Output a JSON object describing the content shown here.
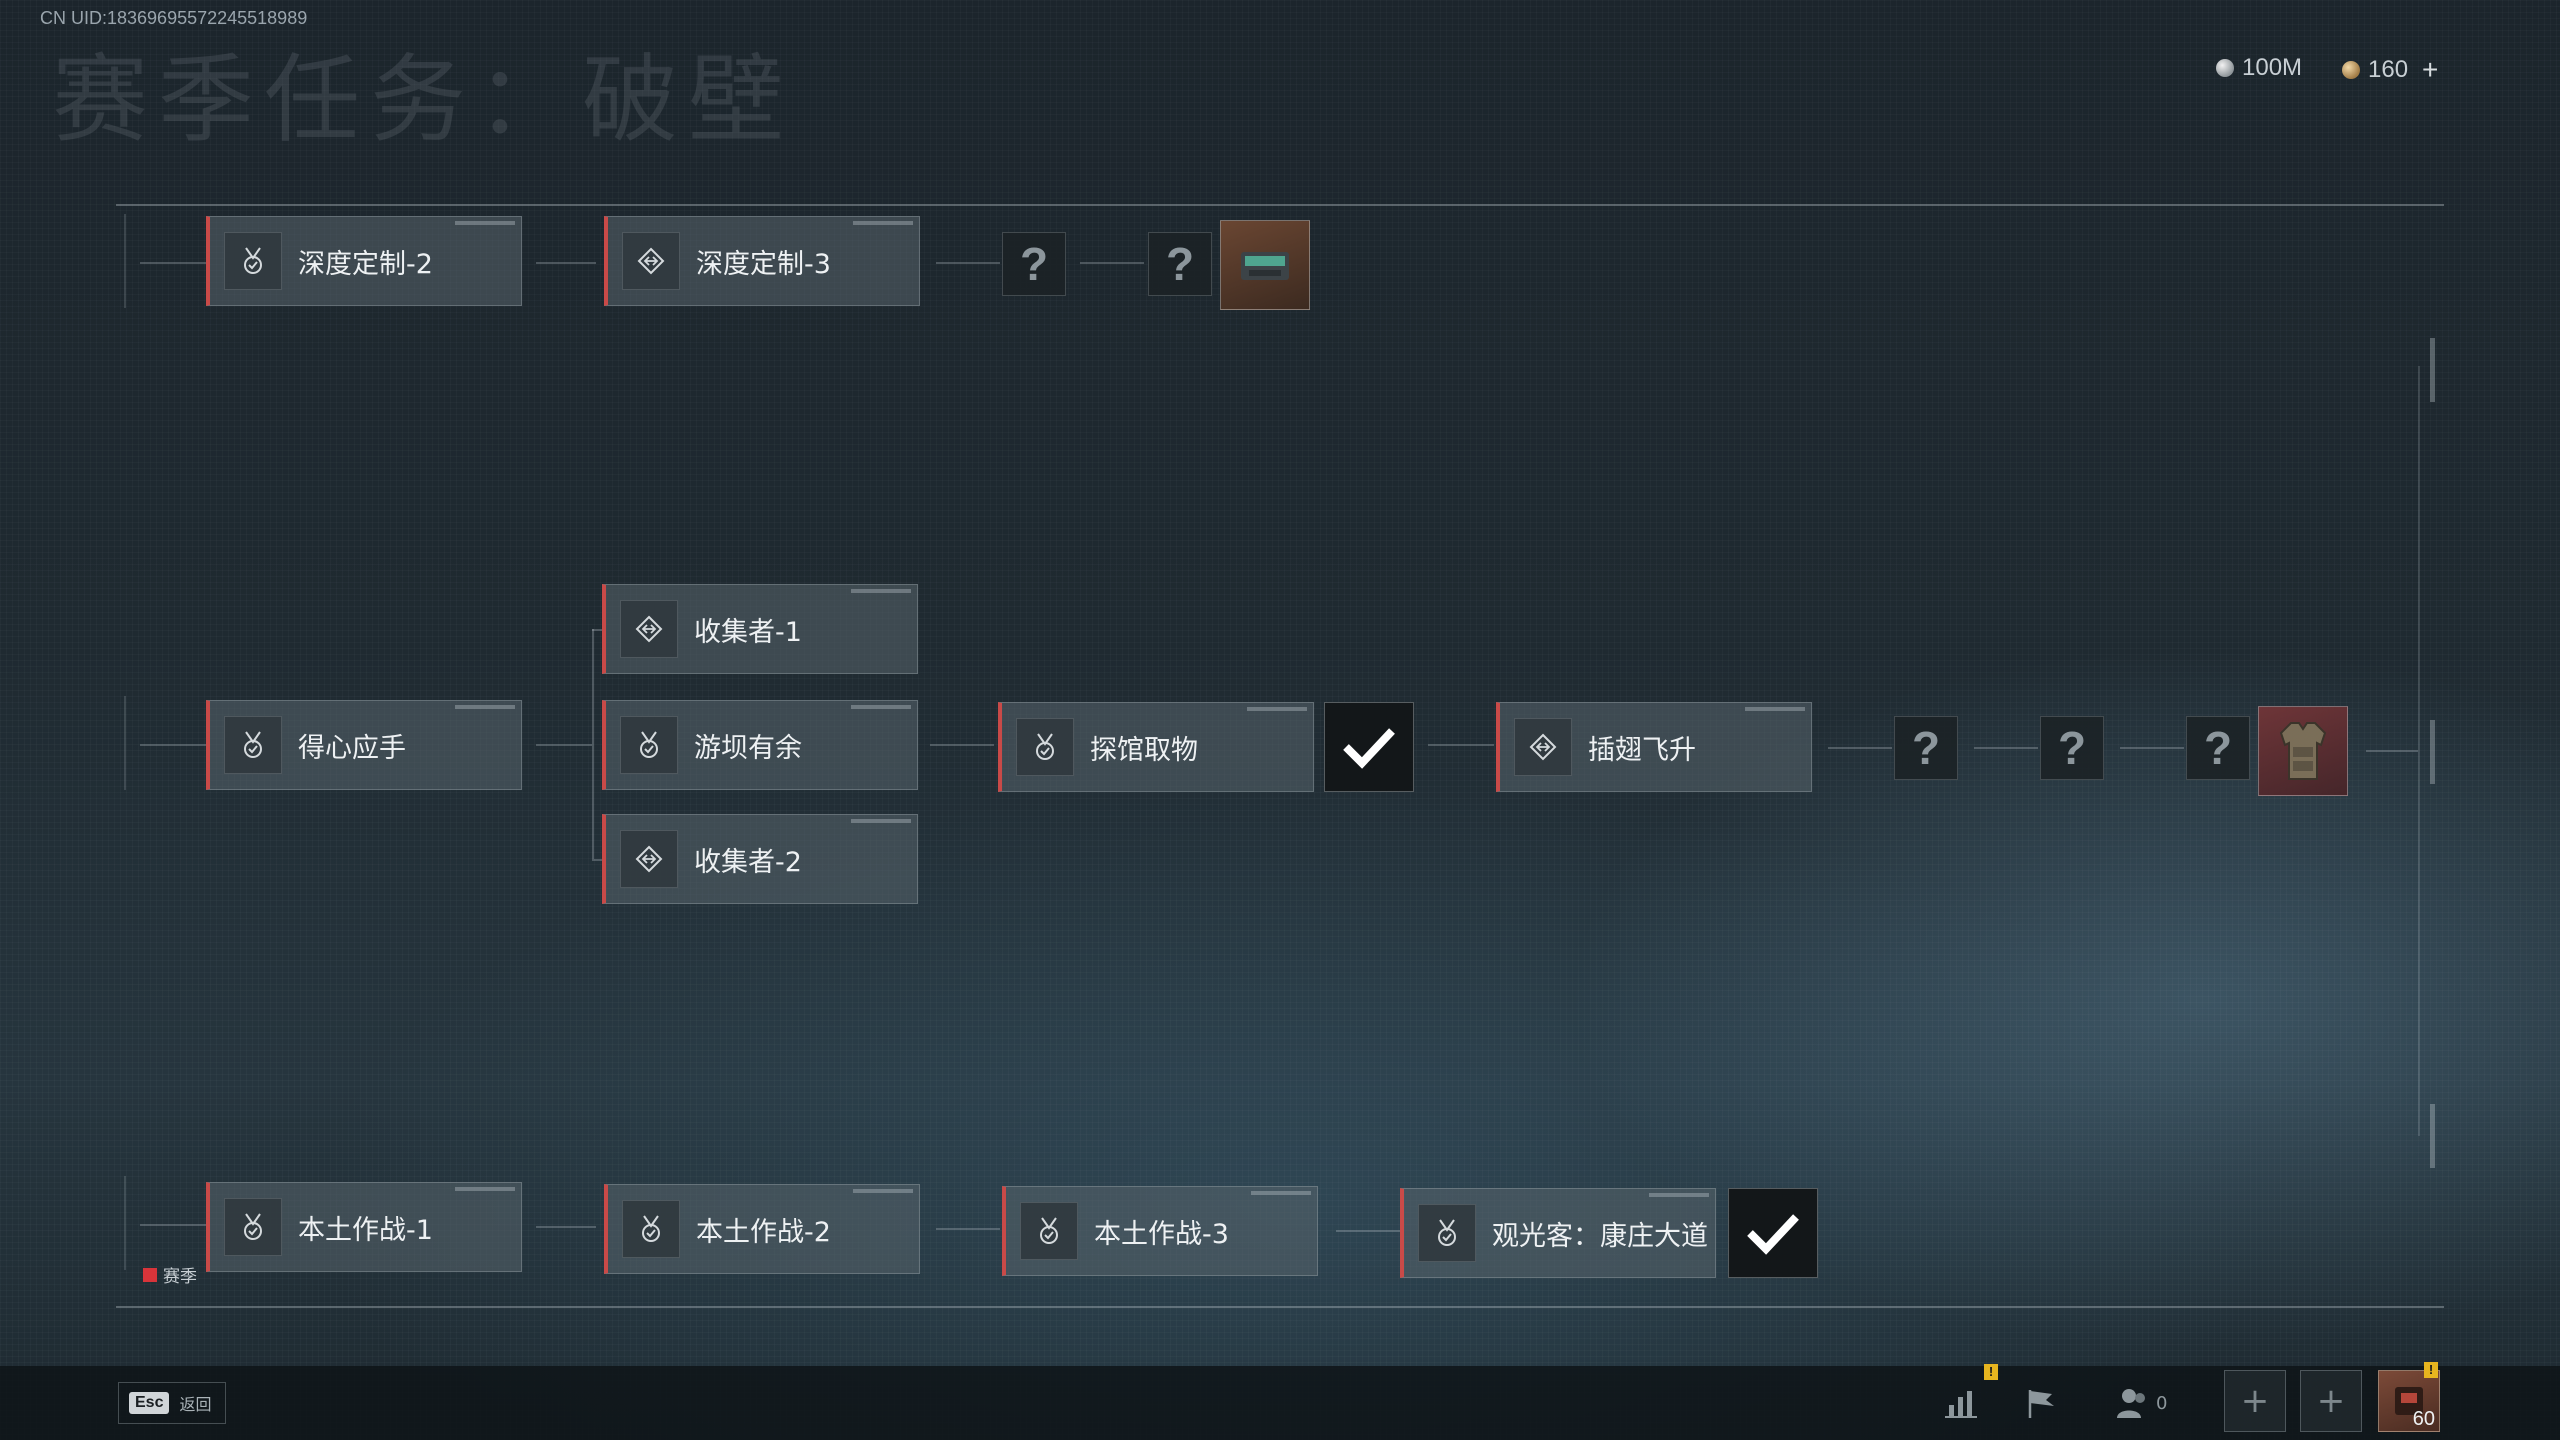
{
  "header": {
    "uid": "CN UID:18369695572245518989",
    "title": "赛季任务：破壁",
    "currencies": [
      {
        "name": "silver-coin",
        "value": "100M"
      },
      {
        "name": "gold-coin",
        "value": "160"
      }
    ],
    "add_label": "+"
  },
  "rows": {
    "top": {
      "tasks": [
        {
          "label": "深度定制-2",
          "icon": "medal-icon"
        },
        {
          "label": "深度定制-3",
          "icon": "diamond-arrows-icon"
        }
      ],
      "unknowns": [
        "?",
        "?"
      ],
      "reward": "gear-case-reward"
    },
    "middle": {
      "start": {
        "label": "得心应手",
        "icon": "medal-icon"
      },
      "branch": [
        {
          "label": "收集者-1",
          "icon": "diamond-arrows-icon"
        },
        {
          "label": "游坝有余",
          "icon": "medal-icon"
        },
        {
          "label": "收集者-2",
          "icon": "diamond-arrows-icon"
        }
      ],
      "next": {
        "label": "探馆取物",
        "icon": "medal-icon",
        "status": "completed"
      },
      "after": {
        "label": "插翅飞升",
        "icon": "diamond-arrows-icon"
      },
      "unknowns": [
        "?",
        "?",
        "?"
      ],
      "reward": "body-armor-reward"
    },
    "bottom": {
      "tasks": [
        {
          "label": "本土作战-1",
          "icon": "medal-icon"
        },
        {
          "label": "本土作战-2",
          "icon": "medal-icon"
        },
        {
          "label": "本土作战-3",
          "icon": "medal-icon"
        },
        {
          "label": "观光客：康庄大道",
          "icon": "medal-icon",
          "status": "completed"
        }
      ]
    }
  },
  "season_tag": "赛季",
  "footer": {
    "esc_key": "Esc",
    "esc_label": "返回",
    "friends_count": "0",
    "bag_count": "60",
    "alert_badge": "!"
  },
  "colors": {
    "accent_red": "#c94a48",
    "season_red": "#d8343a",
    "badge_yellow": "#e7b51f"
  }
}
